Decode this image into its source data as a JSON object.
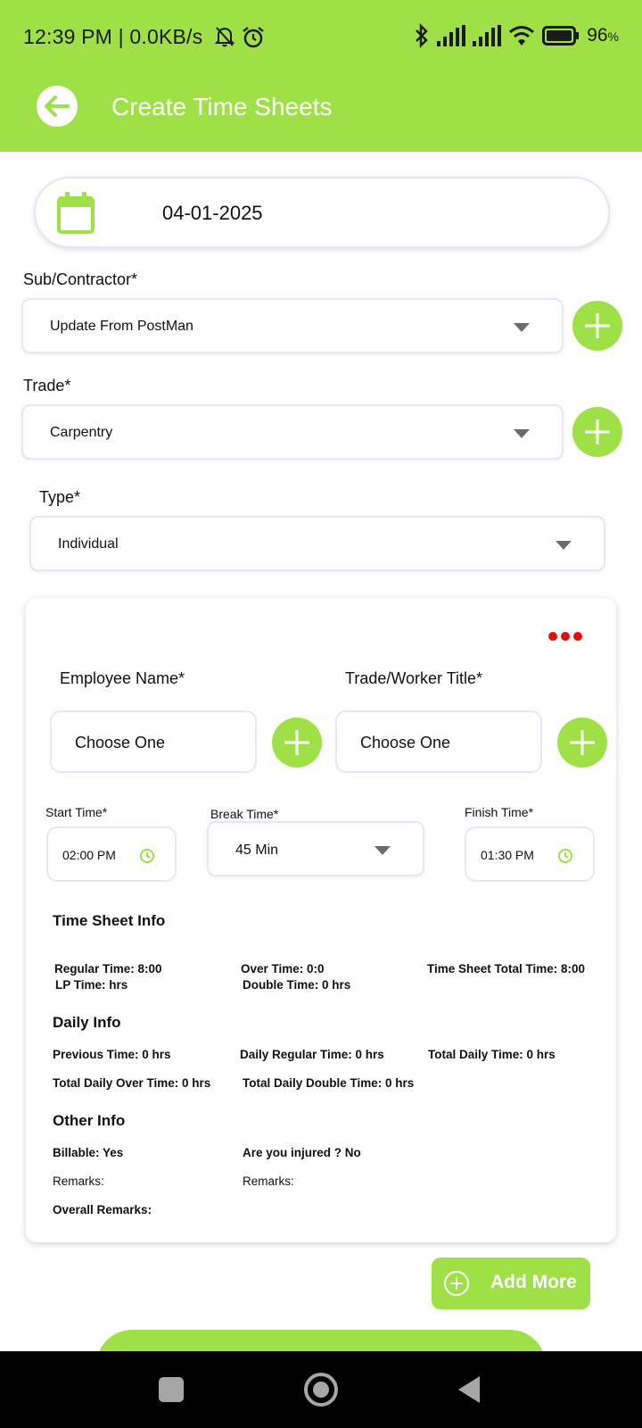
{
  "status_bar": {
    "time": "12:39 PM | 0.0KB/s",
    "battery_percent": "96",
    "battery_unit": "%"
  },
  "app_bar": {
    "title": "Create Time Sheets"
  },
  "date_field": {
    "value": "04-01-2025"
  },
  "form": {
    "sub_contractor": {
      "label": "Sub/Contractor*",
      "value": "Update From PostMan"
    },
    "trade": {
      "label": "Trade*",
      "value": "Carpentry"
    },
    "type": {
      "label": "Type*",
      "value": "Individual"
    }
  },
  "card": {
    "employee": {
      "label": "Employee Name*",
      "value": "Choose One"
    },
    "worker_title": {
      "label": "Trade/Worker Title*",
      "value": "Choose One"
    },
    "start_time": {
      "label": "Start Time*",
      "value": "02:00 PM"
    },
    "break_time": {
      "label": "Break Time*",
      "value": "45 Min"
    },
    "finish_time": {
      "label": "Finish Time*",
      "value": "01:30 PM"
    },
    "time_sheet_info": {
      "heading": "Time Sheet Info",
      "regular_time": "Regular Time:  8:00",
      "over_time": "Over Time:  0:0",
      "total_time": "Time Sheet Total Time:  8:00",
      "lp_time": "LP Time:   hrs",
      "double_time": "Double Time:  0 hrs"
    },
    "daily_info": {
      "heading": "Daily Info",
      "previous_time": "Previous Time:  0 hrs",
      "daily_regular_time": "Daily Regular Time:  0 hrs",
      "total_daily_time": "Total Daily Time:  0 hrs",
      "total_daily_over_time": "Total Daily Over Time:  0 hrs",
      "total_daily_double_time": "Total Daily Double Time:  0 hrs"
    },
    "other_info": {
      "heading": "Other Info",
      "billable": "Billable:  Yes",
      "injured": "Are you injured ?  No",
      "remarks_left": "Remarks:",
      "remarks_right": "Remarks:",
      "overall_remarks": "Overall Remarks:"
    }
  },
  "add_more_label": "Add More",
  "colors": {
    "accent": "#9ee046",
    "more_dots": "#e01010"
  }
}
